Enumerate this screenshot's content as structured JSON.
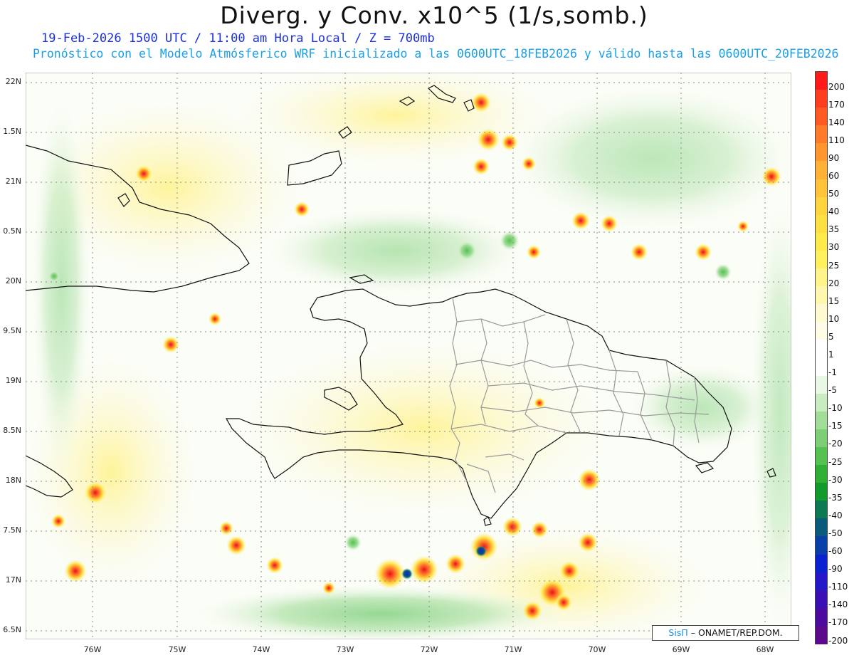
{
  "header": {
    "title": "Diverg. y Conv. x10^5 (1/s,somb.)",
    "line1": "19-Feb-2026  1500 UTC / 11:00 am Hora Local / Z = 700mb",
    "line2": "Pronóstico con el Modelo Atmósferico WRF inicializado a las 0600UTC_18FEB2026 y válido hasta las  0600UTC_20FEB2026"
  },
  "axes": {
    "lat_labels": [
      "22N",
      "1.5N",
      "21N",
      "0.5N",
      "20N",
      "9.5N",
      "19N",
      "8.5N",
      "18N",
      "7.5N",
      "17N",
      "6.5N"
    ],
    "lon_labels": [
      "76W",
      "75W",
      "74W",
      "73W",
      "72W",
      "71W",
      "70W",
      "69W",
      "68W"
    ]
  },
  "colorbar": {
    "labels": [
      "200",
      "170",
      "140",
      "110",
      "90",
      "60",
      "50",
      "40",
      "35",
      "30",
      "25",
      "20",
      "15",
      "10",
      "5",
      "1",
      "-1",
      "-5",
      "-10",
      "-15",
      "-20",
      "-25",
      "-30",
      "-35",
      "-40",
      "-50",
      "-60",
      "-90",
      "-110",
      "-140",
      "-170",
      "-200"
    ],
    "colors": [
      "#ff1a1a",
      "#ff3d1f",
      "#ff5a24",
      "#ff7a2a",
      "#ff9630",
      "#ffb236",
      "#ffc43a",
      "#ffd43e",
      "#ffe044",
      "#ffea4c",
      "#fff05e",
      "#fff48a",
      "#fff7ae",
      "#fffad0",
      "#fffce6",
      "#ffffff",
      "#ffffff",
      "#eaf7e4",
      "#c8ecc0",
      "#a2dd98",
      "#7ccf74",
      "#55c152",
      "#2fb034",
      "#129a2c",
      "#0b7a52",
      "#0a5a7c",
      "#0a3ea8",
      "#0a22d0",
      "#2418c8",
      "#3a10b4",
      "#4c0a9e",
      "#5a0a8a"
    ]
  },
  "credit": {
    "brand": "SisΠ",
    "text": "– ONAMET/REP.DOM."
  }
}
